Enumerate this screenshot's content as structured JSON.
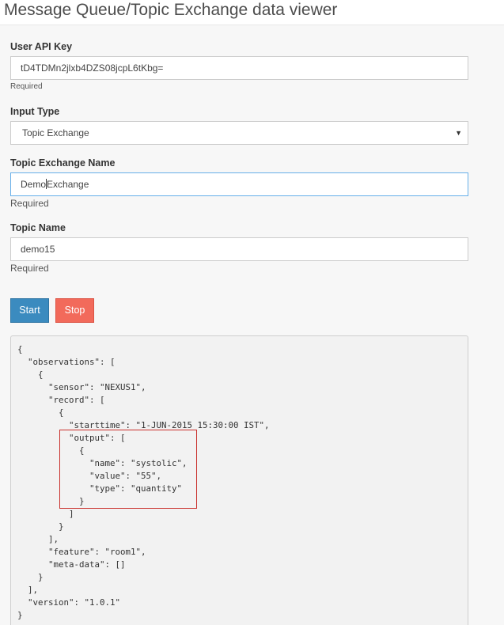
{
  "header": {
    "title": "Message Queue/Topic Exchange data viewer"
  },
  "form": {
    "api_key": {
      "label": "User API Key",
      "value": "tD4TDMn2jlxb4DZS08jcpL6tKbg=",
      "help": "Required"
    },
    "input_type": {
      "label": "Input Type",
      "selected": "Topic Exchange"
    },
    "exchange_name": {
      "label": "Topic Exchange Name",
      "value_before_caret": "Demo",
      "value_after_caret": "Exchange",
      "help": "Required"
    },
    "topic_name": {
      "label": "Topic Name",
      "value": "demo15",
      "help": "Required"
    }
  },
  "buttons": {
    "start": "Start",
    "stop": "Stop"
  },
  "output": {
    "lines": [
      "{",
      "  \"observations\": [",
      "    {",
      "      \"sensor\": \"NEXUS1\",",
      "      \"record\": [",
      "        {",
      "          \"starttime\": \"1-JUN-2015 15:30:00 IST\",",
      "          \"output\": [",
      "            {",
      "              \"name\": \"systolic\",",
      "              \"value\": \"55\",",
      "              \"type\": \"quantity\"",
      "            }",
      "          ]",
      "        }",
      "      ],",
      "      \"feature\": \"room1\",",
      "      \"meta-data\": []",
      "    }",
      "  ],",
      "  \"version\": \"1.0.1\"",
      "}"
    ]
  },
  "colors": {
    "start_button": "#3b8bbf",
    "stop_button": "#f26a5b",
    "highlight_border": "#c9302c",
    "focus_border": "#66afe9"
  }
}
